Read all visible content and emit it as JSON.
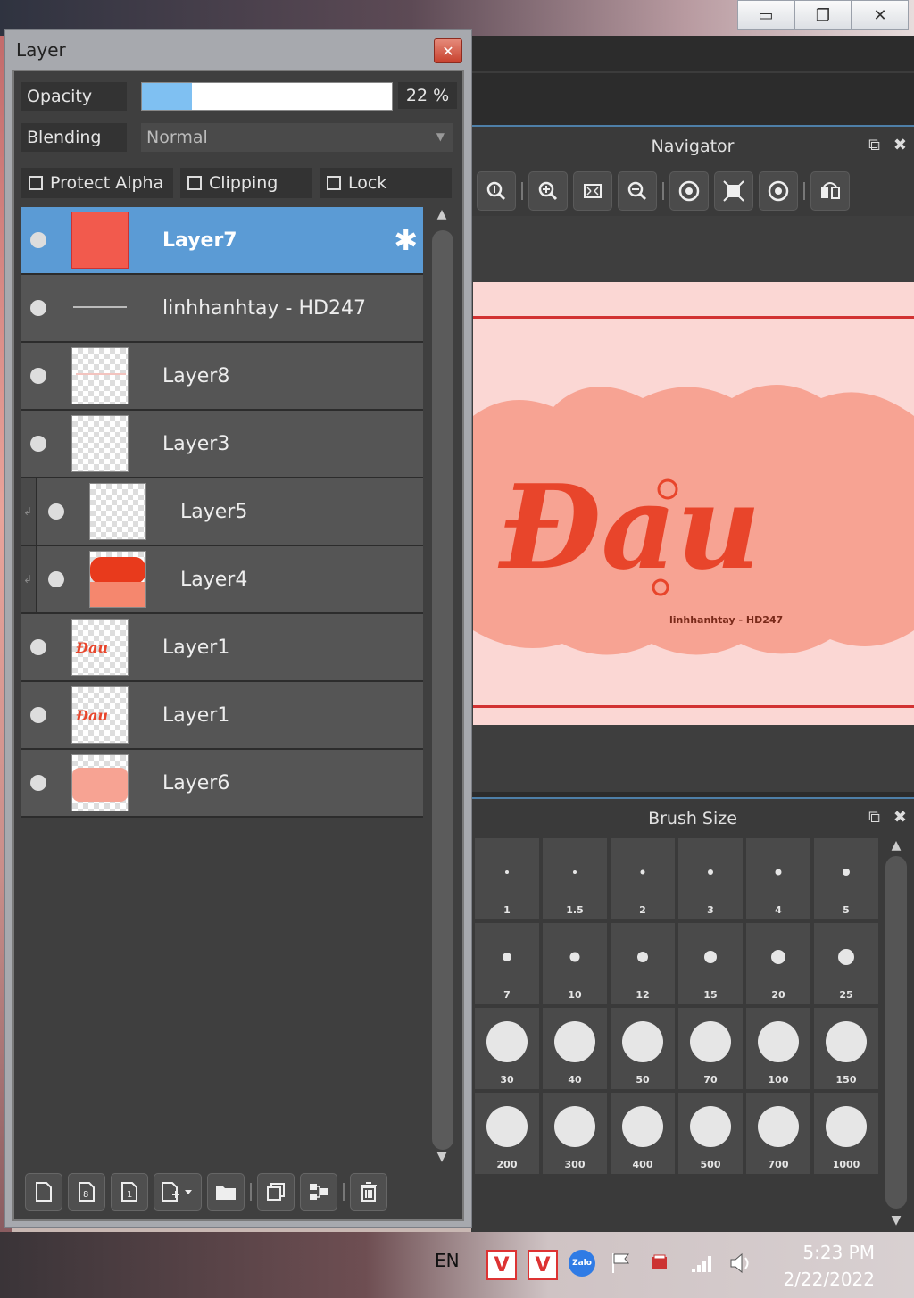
{
  "window_controls": {
    "minimize": "▭",
    "restore": "❐",
    "close": "✕"
  },
  "layer_panel": {
    "title": "Layer",
    "close_symbol": "✕",
    "opacity_label": "Opacity",
    "opacity_value": "22 %",
    "opacity_fraction": 0.2,
    "blending_label": "Blending",
    "blending_value": "Normal",
    "checkboxes": {
      "protect_alpha": "Protect Alpha",
      "clipping": "Clipping",
      "lock": "Lock"
    },
    "layers": [
      {
        "name": "Layer7",
        "selected": true,
        "clipped": false,
        "thumb": "red"
      },
      {
        "name": "linhhanhtay - HD247",
        "selected": false,
        "clipped": false,
        "thumb": "text"
      },
      {
        "name": "Layer8",
        "selected": false,
        "clipped": false,
        "thumb": "faint"
      },
      {
        "name": "Layer3",
        "selected": false,
        "clipped": false,
        "thumb": "empty"
      },
      {
        "name": "Layer5",
        "selected": false,
        "clipped": true,
        "thumb": "empty"
      },
      {
        "name": "Layer4",
        "selected": false,
        "clipped": true,
        "thumb": "orange"
      },
      {
        "name": "Layer1",
        "selected": false,
        "clipped": false,
        "thumb": "word"
      },
      {
        "name": "Layer1",
        "selected": false,
        "clipped": false,
        "thumb": "word2"
      },
      {
        "name": "Layer6",
        "selected": false,
        "clipped": false,
        "thumb": "cloud"
      }
    ],
    "toolbar_icons": [
      "new-layer-icon",
      "new-8bit-layer-icon",
      "new-1bit-layer-icon",
      "add-layer-menu-icon",
      "folder-icon",
      "duplicate-icon",
      "merge-down-icon",
      "delete-icon"
    ]
  },
  "navigator": {
    "title": "Navigator",
    "canvas_text": "linhhanhtay - HD247",
    "tools": [
      "zoom-actual-icon",
      "zoom-in-icon",
      "fit-icon",
      "zoom-out-icon",
      "rotate-left-icon",
      "reset-view-icon",
      "rotate-right-icon",
      "flip-icon"
    ]
  },
  "brush_size": {
    "title": "Brush Size",
    "sizes": [
      "1",
      "1.5",
      "2",
      "3",
      "4",
      "5",
      "7",
      "10",
      "12",
      "15",
      "20",
      "25",
      "30",
      "40",
      "50",
      "70",
      "100",
      "150",
      "200",
      "300",
      "400",
      "500",
      "700",
      "1000"
    ]
  },
  "taskbar": {
    "language": "EN",
    "time": "5:23 PM",
    "date": "2/22/2022",
    "zalo": "Zalo"
  },
  "colors": {
    "accent": "#5b9bd5",
    "canvas_bg": "#fbd7d4",
    "cloud": "#f7a393",
    "lettering": "#e8452b"
  }
}
